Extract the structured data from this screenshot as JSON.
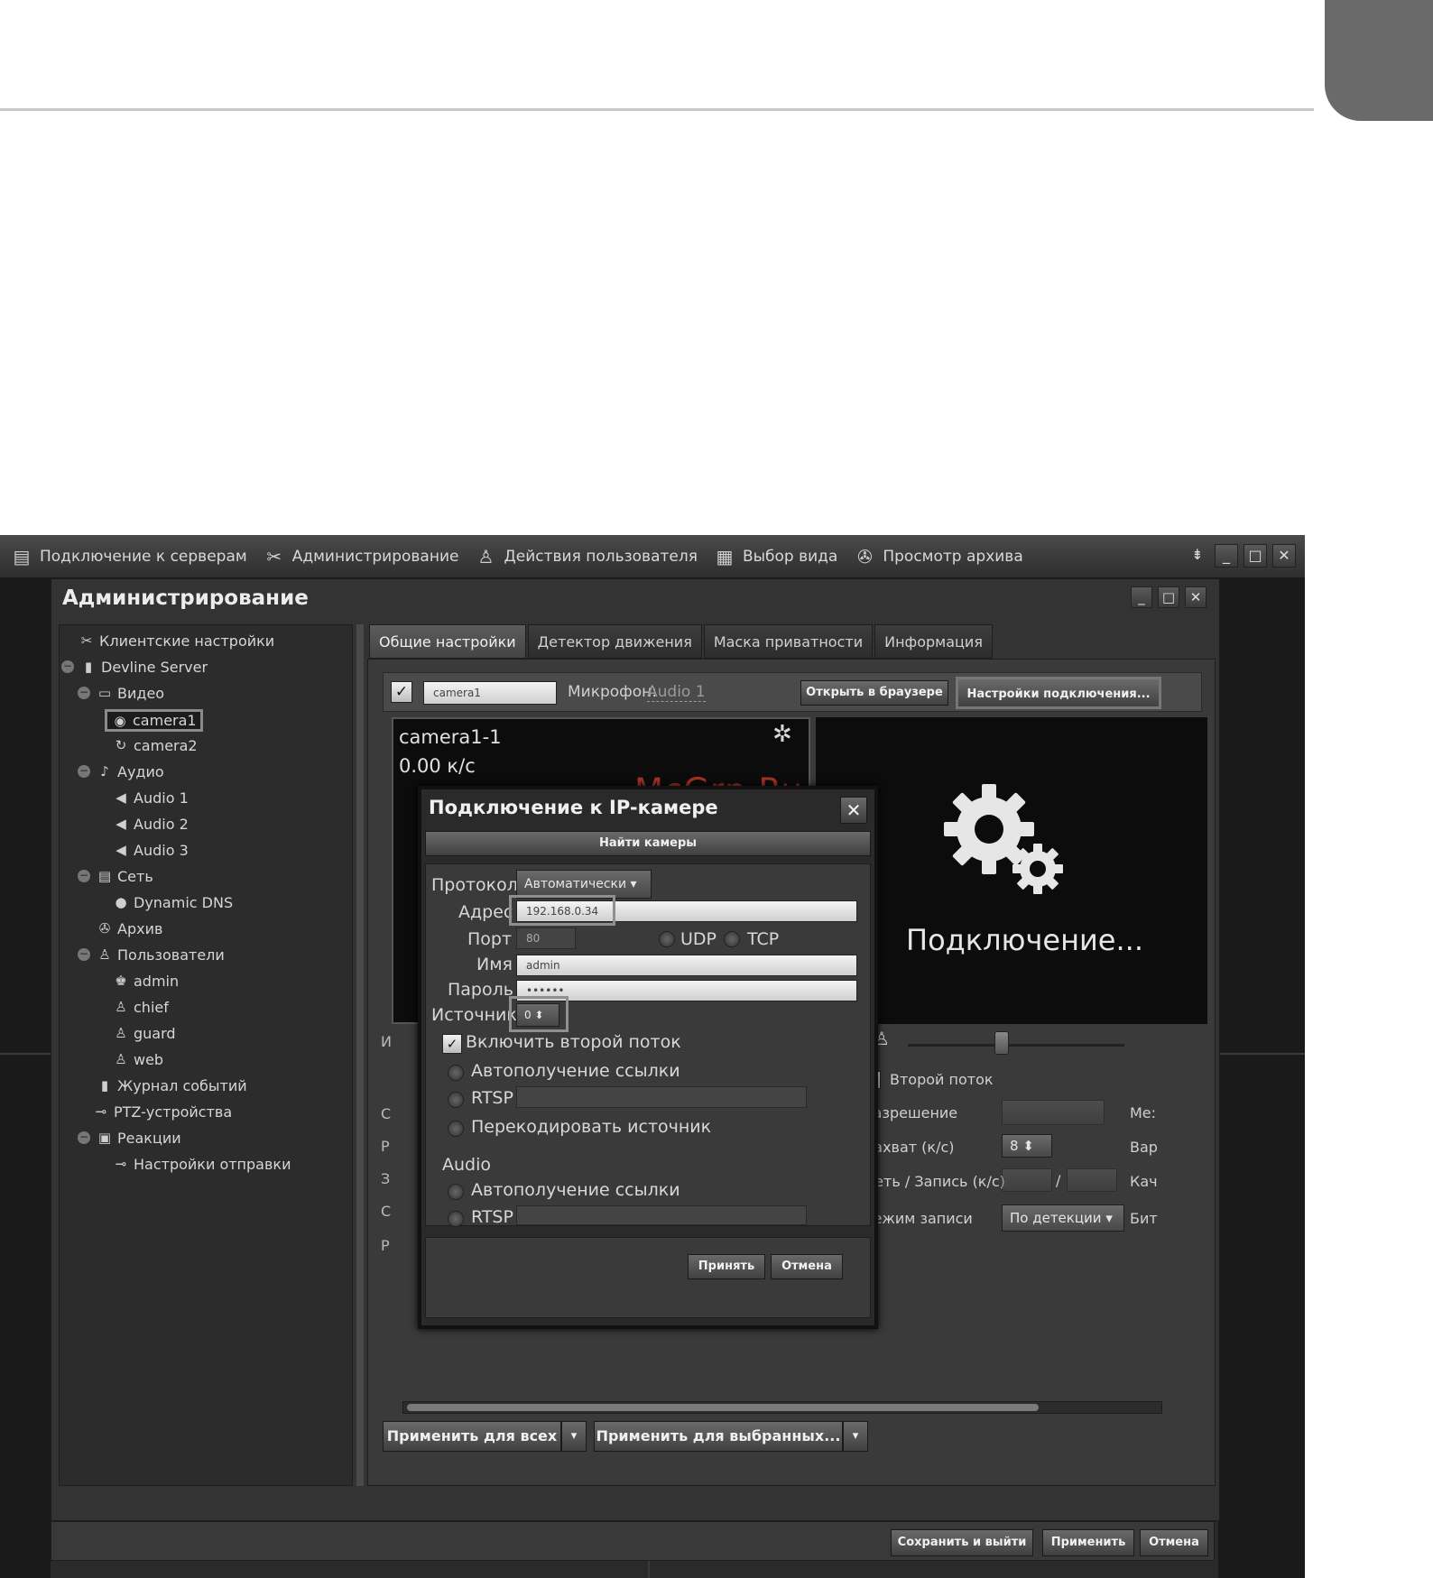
{
  "menubar": {
    "items": [
      {
        "label": "Подключение к серверам",
        "icon": "server-icon"
      },
      {
        "label": "Администрирование",
        "icon": "tools-icon"
      },
      {
        "label": "Действия пользователя",
        "icon": "user-icon"
      },
      {
        "label": "Выбор вида",
        "icon": "grid-icon"
      },
      {
        "label": "Просмотр архива",
        "icon": "film-icon"
      }
    ]
  },
  "admin": {
    "title": "Администрирование"
  },
  "tree": {
    "client_settings": "Клиентские настройки",
    "server": "Devline Server",
    "video": "Видео",
    "camera1": "camera1",
    "camera2": "camera2",
    "audio": "Аудио",
    "audio1": "Audio 1",
    "audio2": "Audio 2",
    "audio3": "Audio 3",
    "network": "Сеть",
    "ddns": "Dynamic DNS",
    "archive": "Архив",
    "users": "Пользователи",
    "user_admin": "admin",
    "user_chief": "chief",
    "user_guard": "guard",
    "user_web": "web",
    "event_log": "Журнал событий",
    "ptz": "PTZ-устройства",
    "reactions": "Реакции",
    "send_settings": "Настройки отправки"
  },
  "tabs": [
    "Общие настройки",
    "Детектор движения",
    "Маска приватности",
    "Информация"
  ],
  "camera": {
    "name": "camera1",
    "mic_label": "Микрофон:",
    "mic_value": "Audio 1",
    "open_browser": "Открыть в браузере",
    "conn_settings": "Настройки подключения...",
    "stream_name": "camera1-1",
    "stream_rate": "0.00 к/с",
    "connecting": "Подключение..."
  },
  "watermark": "McGrp.Ru",
  "dialog": {
    "title": "Подключение к IP-камере",
    "find": "Найти камеры",
    "protocol_label": "Протокол",
    "protocol_value": "Автоматически",
    "address_label": "Адрес",
    "address_value": "192.168.0.34",
    "port_label": "Порт",
    "port_value": "80",
    "udp": "UDP",
    "tcp": "TCP",
    "name_label": "Имя",
    "name_value": "admin",
    "password_label": "Пароль",
    "password_value": "••••••",
    "source_label": "Источник",
    "source_value": "0",
    "second_stream": "Включить второй поток",
    "auto_link": "Автополучение ссылки",
    "rtsp": "RTSP",
    "transcode": "Перекодировать источник",
    "audio_header": "Audio",
    "audio_auto_link": "Автополучение ссылки",
    "audio_rtsp": "RTSP",
    "apply": "Принять",
    "cancel": "Отмена"
  },
  "right_panel": {
    "second_stream": "Второй поток",
    "resolution": "Разрешение",
    "capture": "Захват (к/с)",
    "capture_value": "8",
    "net_rec": "Сеть / Запись (к/с)",
    "slash": "/",
    "rec_mode": "Режим записи",
    "rec_mode_value": "По детекции",
    "cut_me": "Ме:",
    "cut_var": "Вар",
    "cut_kach": "Кач",
    "cut_bit": "Бит"
  },
  "bottom": {
    "apply_all": "Применить для всех",
    "apply_selected": "Применить для выбранных...",
    "save_exit": "Сохранить и выйти",
    "apply": "Применить",
    "cancel": "Отмена"
  }
}
